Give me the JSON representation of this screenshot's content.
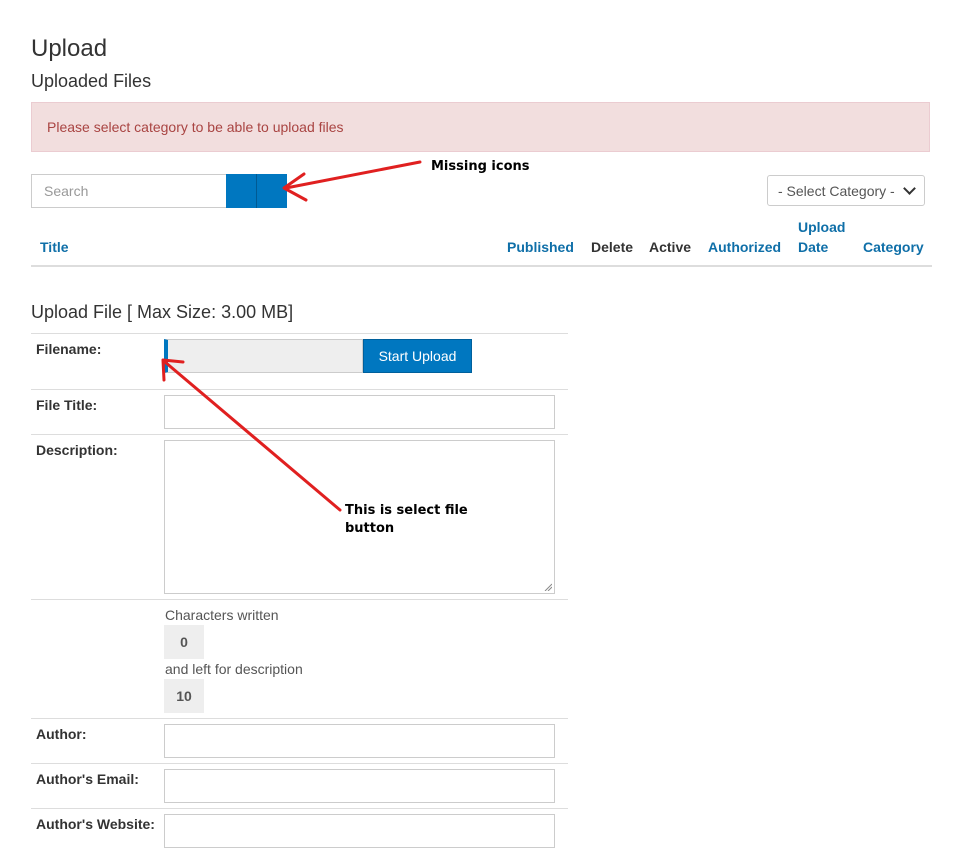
{
  "page": {
    "title": "Upload",
    "subtitle": "Uploaded Files"
  },
  "alert": {
    "message": "Please select category to be able to upload files"
  },
  "search": {
    "placeholder": "Search",
    "value": ""
  },
  "category_select": {
    "selected": "- Select Category -"
  },
  "table": {
    "columns": [
      {
        "label": "Title",
        "sortable": true
      },
      {
        "label": "Published",
        "sortable": true
      },
      {
        "label": "Delete",
        "sortable": false
      },
      {
        "label": "Active",
        "sortable": false
      },
      {
        "label": "Authorized",
        "sortable": true
      },
      {
        "label": "Upload Date",
        "line1": "Upload",
        "line2": "Date",
        "sortable": true
      },
      {
        "label": "Category",
        "sortable": true
      }
    ]
  },
  "upload_form": {
    "title": "Upload File [ Max Size: 3.00 MB]",
    "filename_label": "Filename:",
    "start_upload_label": "Start Upload",
    "file_title_label": "File Title:",
    "description_label": "Description:",
    "chars_written_label": "Characters written",
    "chars_written_value": "0",
    "chars_left_label": "and left for description",
    "chars_left_value": "10",
    "author_label": "Author:",
    "author_email_label": "Author's Email:",
    "author_website_label": "Author's Website:"
  },
  "annotations": {
    "missing_icons": "Missing icons",
    "select_file_line1": "This is select file",
    "select_file_line2": "button"
  },
  "colors": {
    "primary": "#0077c0",
    "link": "#0f6fa8",
    "alert_bg": "#f2dede",
    "alert_text": "#a94442",
    "annotation_arrow": "#e02020"
  }
}
